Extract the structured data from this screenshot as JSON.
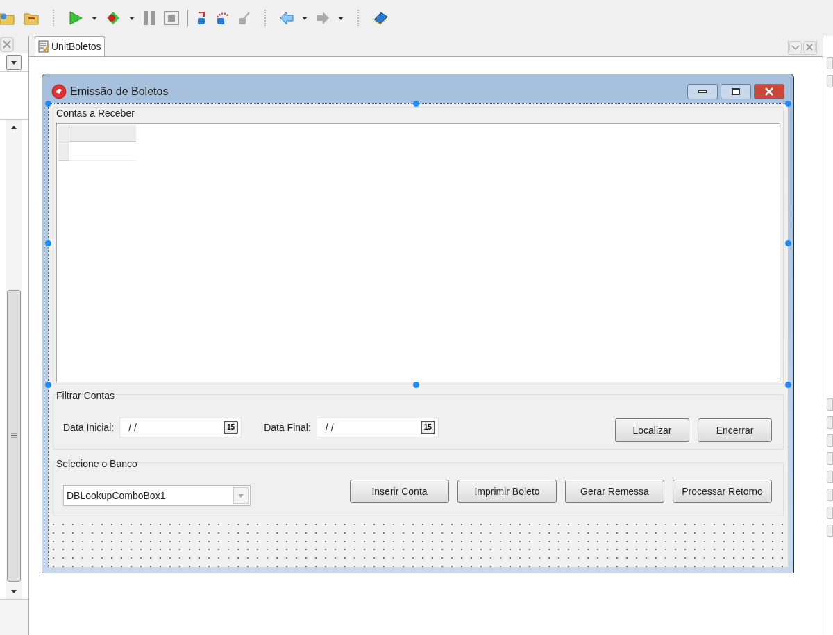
{
  "editor_tab": {
    "label": "UnitBoletos",
    "selected": true
  },
  "form": {
    "title": "Emissão de Boletos",
    "accounts_group": {
      "label": "Contas a Receber"
    },
    "filter_group": {
      "label": "Filtrar Contas",
      "fields": [
        {
          "label": "Data Inicial:",
          "value": "/ /",
          "calendar_label": "15"
        },
        {
          "label": "Data Final:",
          "value": "/ /",
          "calendar_label": "15"
        }
      ],
      "buttons": [
        "Localizar",
        "Encerrar"
      ]
    },
    "bank_group": {
      "label": "Selecione o Banco",
      "combo_value": "DBLookupComboBox1",
      "buttons": [
        "Inserir Conta",
        "Imprimir Boleto",
        "Gerar Remessa",
        "Processar Retorno"
      ]
    }
  }
}
